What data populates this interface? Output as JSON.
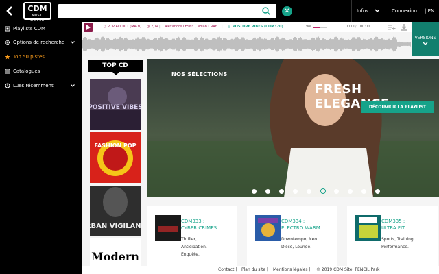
{
  "header": {
    "logo_text": "CDM",
    "logo_sub": "MUSIC LIBRARY",
    "search": {
      "value": "",
      "placeholder": ""
    },
    "infos_label": "Infos",
    "connexion_label": "Connexion",
    "lang_label": "| EN"
  },
  "sidebar": {
    "items": [
      {
        "label": "Playlists CDM",
        "icon": "playlist-icon"
      },
      {
        "label": "Options de recherche",
        "icon": "gear-icon"
      },
      {
        "label": "Top 50 pistes",
        "icon": "star-icon",
        "active": true
      },
      {
        "label": "Catalogues",
        "icon": "catalog-icon"
      },
      {
        "label": "Lues récemment",
        "icon": "history-icon"
      }
    ]
  },
  "player": {
    "track_title": "POP ADDICT (MAIN)",
    "duration": "2,14",
    "artists": "Alexandre LESNY , Nolan CRAY",
    "album": "POSITIVE VIBES (CDM320)",
    "vol_label": "Vol",
    "volume": 0.55,
    "time_elapsed": "00:00",
    "time_total": "00:00",
    "versions_label": "VERSIONS"
  },
  "top_cd": {
    "label": "TOP CD",
    "albums": [
      {
        "title": "POSITIVE VIBES"
      },
      {
        "title": "FASHION POP"
      },
      {
        "title": "URBAN VIGILANTE"
      },
      {
        "title": "Modern"
      }
    ]
  },
  "hero": {
    "section_title": "NOS SÉLECTIONS",
    "playlist_name": "FRESH ELEGANCE",
    "button_label": "DÉCOUVRIR LA PLAYLIST",
    "dots_count": 10,
    "active_dot": 5
  },
  "cards": [
    {
      "title": "CDM333 :\nCYBER CRIMES",
      "desc": "Thriller,\nAnticipation,\nEnquête."
    },
    {
      "title": "CDM334 :\nELECTRO WARM",
      "desc": "Downtempo, Neo\nDisco, Lounge."
    },
    {
      "title": "CDM335 :\nULTRA FIT",
      "desc": "Sports, Training,\nPerformance."
    }
  ],
  "footer": {
    "contact": "Contact |",
    "plan": "Plan du site |",
    "legal": "Mentions légales |",
    "copyright": "© 2019 CDM Site: PENCIL Park"
  },
  "colors": {
    "accent": "#16a38a",
    "player_accent": "#a21550",
    "active_nav": "#ff9f1c",
    "versions_bg": "#127f6e"
  }
}
